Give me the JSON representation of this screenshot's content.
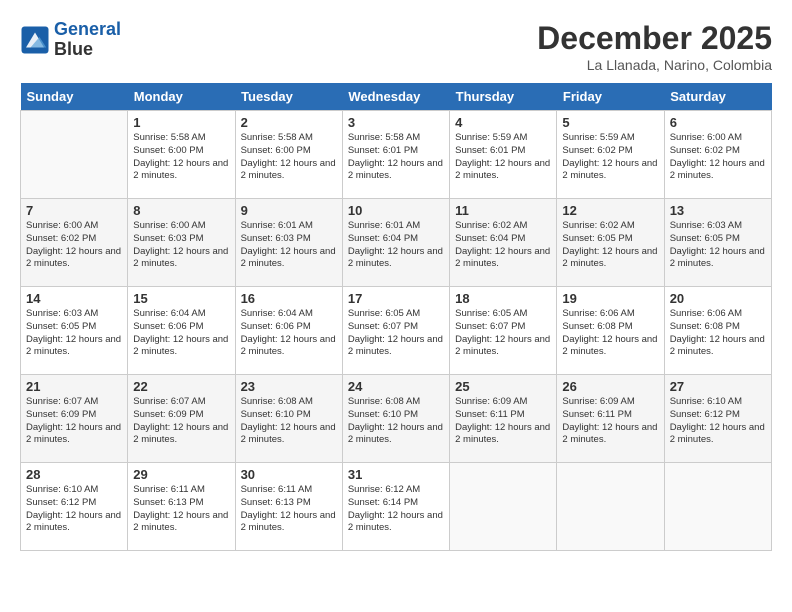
{
  "header": {
    "logo_line1": "General",
    "logo_line2": "Blue",
    "month": "December 2025",
    "location": "La Llanada, Narino, Colombia"
  },
  "weekdays": [
    "Sunday",
    "Monday",
    "Tuesday",
    "Wednesday",
    "Thursday",
    "Friday",
    "Saturday"
  ],
  "weeks": [
    [
      {
        "day": "",
        "info": ""
      },
      {
        "day": "1",
        "info": "Sunrise: 5:58 AM\nSunset: 6:00 PM\nDaylight: 12 hours and 2 minutes."
      },
      {
        "day": "2",
        "info": "Sunrise: 5:58 AM\nSunset: 6:00 PM\nDaylight: 12 hours and 2 minutes."
      },
      {
        "day": "3",
        "info": "Sunrise: 5:58 AM\nSunset: 6:01 PM\nDaylight: 12 hours and 2 minutes."
      },
      {
        "day": "4",
        "info": "Sunrise: 5:59 AM\nSunset: 6:01 PM\nDaylight: 12 hours and 2 minutes."
      },
      {
        "day": "5",
        "info": "Sunrise: 5:59 AM\nSunset: 6:02 PM\nDaylight: 12 hours and 2 minutes."
      },
      {
        "day": "6",
        "info": "Sunrise: 6:00 AM\nSunset: 6:02 PM\nDaylight: 12 hours and 2 minutes."
      }
    ],
    [
      {
        "day": "7",
        "info": "Sunrise: 6:00 AM\nSunset: 6:02 PM\nDaylight: 12 hours and 2 minutes."
      },
      {
        "day": "8",
        "info": "Sunrise: 6:00 AM\nSunset: 6:03 PM\nDaylight: 12 hours and 2 minutes."
      },
      {
        "day": "9",
        "info": "Sunrise: 6:01 AM\nSunset: 6:03 PM\nDaylight: 12 hours and 2 minutes."
      },
      {
        "day": "10",
        "info": "Sunrise: 6:01 AM\nSunset: 6:04 PM\nDaylight: 12 hours and 2 minutes."
      },
      {
        "day": "11",
        "info": "Sunrise: 6:02 AM\nSunset: 6:04 PM\nDaylight: 12 hours and 2 minutes."
      },
      {
        "day": "12",
        "info": "Sunrise: 6:02 AM\nSunset: 6:05 PM\nDaylight: 12 hours and 2 minutes."
      },
      {
        "day": "13",
        "info": "Sunrise: 6:03 AM\nSunset: 6:05 PM\nDaylight: 12 hours and 2 minutes."
      }
    ],
    [
      {
        "day": "14",
        "info": "Sunrise: 6:03 AM\nSunset: 6:05 PM\nDaylight: 12 hours and 2 minutes."
      },
      {
        "day": "15",
        "info": "Sunrise: 6:04 AM\nSunset: 6:06 PM\nDaylight: 12 hours and 2 minutes."
      },
      {
        "day": "16",
        "info": "Sunrise: 6:04 AM\nSunset: 6:06 PM\nDaylight: 12 hours and 2 minutes."
      },
      {
        "day": "17",
        "info": "Sunrise: 6:05 AM\nSunset: 6:07 PM\nDaylight: 12 hours and 2 minutes."
      },
      {
        "day": "18",
        "info": "Sunrise: 6:05 AM\nSunset: 6:07 PM\nDaylight: 12 hours and 2 minutes."
      },
      {
        "day": "19",
        "info": "Sunrise: 6:06 AM\nSunset: 6:08 PM\nDaylight: 12 hours and 2 minutes."
      },
      {
        "day": "20",
        "info": "Sunrise: 6:06 AM\nSunset: 6:08 PM\nDaylight: 12 hours and 2 minutes."
      }
    ],
    [
      {
        "day": "21",
        "info": "Sunrise: 6:07 AM\nSunset: 6:09 PM\nDaylight: 12 hours and 2 minutes."
      },
      {
        "day": "22",
        "info": "Sunrise: 6:07 AM\nSunset: 6:09 PM\nDaylight: 12 hours and 2 minutes."
      },
      {
        "day": "23",
        "info": "Sunrise: 6:08 AM\nSunset: 6:10 PM\nDaylight: 12 hours and 2 minutes."
      },
      {
        "day": "24",
        "info": "Sunrise: 6:08 AM\nSunset: 6:10 PM\nDaylight: 12 hours and 2 minutes."
      },
      {
        "day": "25",
        "info": "Sunrise: 6:09 AM\nSunset: 6:11 PM\nDaylight: 12 hours and 2 minutes."
      },
      {
        "day": "26",
        "info": "Sunrise: 6:09 AM\nSunset: 6:11 PM\nDaylight: 12 hours and 2 minutes."
      },
      {
        "day": "27",
        "info": "Sunrise: 6:10 AM\nSunset: 6:12 PM\nDaylight: 12 hours and 2 minutes."
      }
    ],
    [
      {
        "day": "28",
        "info": "Sunrise: 6:10 AM\nSunset: 6:12 PM\nDaylight: 12 hours and 2 minutes."
      },
      {
        "day": "29",
        "info": "Sunrise: 6:11 AM\nSunset: 6:13 PM\nDaylight: 12 hours and 2 minutes."
      },
      {
        "day": "30",
        "info": "Sunrise: 6:11 AM\nSunset: 6:13 PM\nDaylight: 12 hours and 2 minutes."
      },
      {
        "day": "31",
        "info": "Sunrise: 6:12 AM\nSunset: 6:14 PM\nDaylight: 12 hours and 2 minutes."
      },
      {
        "day": "",
        "info": ""
      },
      {
        "day": "",
        "info": ""
      },
      {
        "day": "",
        "info": ""
      }
    ]
  ]
}
